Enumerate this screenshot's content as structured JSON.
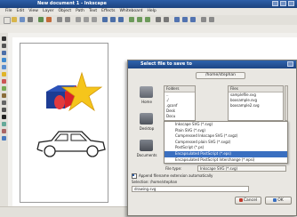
{
  "window": {
    "title": "New document 1 - Inkscape",
    "menus": [
      "File",
      "Edit",
      "View",
      "Layer",
      "Object",
      "Path",
      "Text",
      "Effects",
      "Whiteboard",
      "Help"
    ]
  },
  "dialog": {
    "title": "Select file to save to",
    "path_button": "/home/stephan",
    "places": [
      "Home",
      "Desktop",
      "Documents"
    ],
    "folders_header": "Folders",
    "folders": [
      "..",
      "./",
      ".gconf",
      "Desk",
      "Docu",
      "Docu"
    ],
    "files_header": "Files",
    "files": [
      "samplefile.svg",
      "boxsample.svg",
      "boxsample2.svg"
    ],
    "file_types": [
      "Inkscape SVG (*.svg)",
      "Plain SVG (*.svg)",
      "Compressed Inkscape SVG (*.svgz)",
      "Compressed plain SVG (*.svgz)",
      "PostScript (*.ps)",
      "Encapsulated PostScript (*.eps)",
      "Encapsulated PostScript Interchange (*.epsi)",
      "PDF via Cairo (*.pdf)"
    ],
    "selected_type_index": 5,
    "file_type_label": "File type:",
    "file_type_value": "Inkscape SVG (*.svg)",
    "append_extension_label": "Append filename extension automatically",
    "selection_label": "Selection: /home/stephan",
    "filename": "drawing.svg",
    "cancel_label": "Cancel",
    "ok_label": "OK"
  },
  "colors": {
    "star": "#f5c51b",
    "box_red": "#d9232a",
    "box_blue": "#1f3f99",
    "accent": "#3a6fc0"
  }
}
